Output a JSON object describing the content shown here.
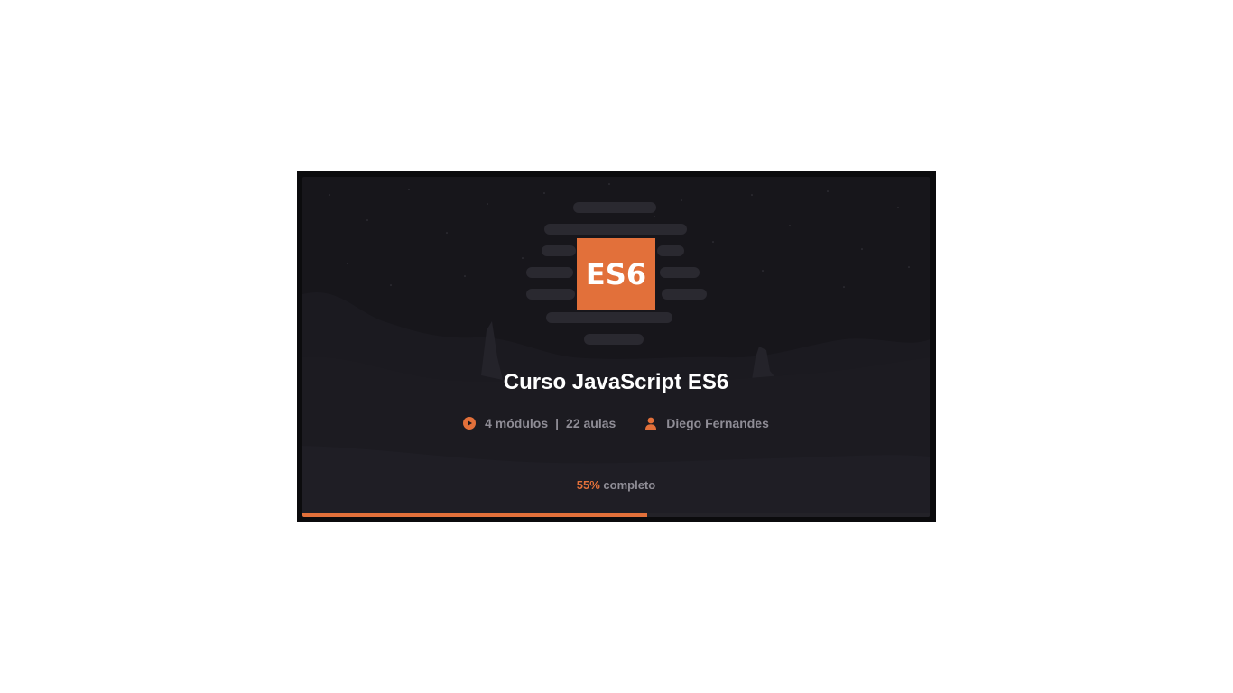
{
  "course": {
    "logo_text": "ES6",
    "title": "Curso JavaScript ES6",
    "modules": "4 módulos",
    "separator": "|",
    "lessons": "22 aulas",
    "author": "Diego Fernandes",
    "progress_percent": 55,
    "progress_percent_label": "55%",
    "progress_suffix": "completo"
  },
  "colors": {
    "accent": "#e2703a",
    "background": "#17161b",
    "muted_text": "#8f8d96"
  },
  "icons": {
    "modules": "play-circle-icon",
    "author": "user-icon"
  }
}
